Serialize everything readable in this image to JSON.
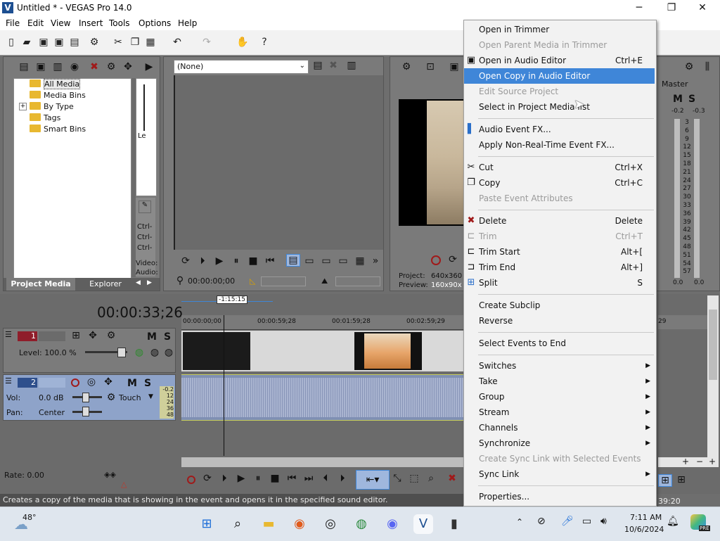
{
  "window": {
    "title": "Untitled * - VEGAS Pro 14.0",
    "minimize": "─",
    "maximize": "❐",
    "close": "✕"
  },
  "menubar": [
    "File",
    "Edit",
    "View",
    "Insert",
    "Tools",
    "Options",
    "Help"
  ],
  "explorer": {
    "tree": [
      "All Media",
      "Media Bins",
      "By Type",
      "Tags",
      "Smart Bins"
    ],
    "expander": "+",
    "tabs": [
      "Project Media",
      "Explorer"
    ],
    "side_text": [
      "Le",
      "Ctrl-",
      "Ctrl-",
      "Ctrl-",
      "Video:",
      "Audio:"
    ]
  },
  "trimmer": {
    "dropdown": "(None)",
    "timecode": "00:00:00;00"
  },
  "preview": {
    "project_label": "Project:",
    "project_value": "640x360",
    "preview_label": "Preview:",
    "preview_value": "160x90x"
  },
  "master": {
    "title": "Master",
    "mute": "M",
    "solo": "S",
    "peak_l": "-0.2",
    "peak_r": "-0.3",
    "scale": [
      "3",
      "6",
      "9",
      "12",
      "15",
      "18",
      "21",
      "24",
      "27",
      "30",
      "33",
      "36",
      "39",
      "42",
      "45",
      "48",
      "51",
      "54",
      "57"
    ],
    "bottom_l": "0.0",
    "bottom_r": "0.0"
  },
  "timeline": {
    "timecode": "00:00:33;26",
    "marker": "-1:15:15",
    "ruler": [
      "00:00:00;00",
      "00:00:59;28",
      "00:01:59;28",
      "00:02:59;29"
    ],
    "ruler_right": "29",
    "end_time": "39:20",
    "track1": {
      "number": "1",
      "level": "Level: 100.0 %",
      "mute": "M",
      "solo": "S"
    },
    "track2": {
      "number": "2",
      "vol_label": "Vol:",
      "vol_value": "0.0 dB",
      "pan_label": "Pan:",
      "pan_value": "Center",
      "automation": "Touch",
      "mute": "M",
      "solo": "S",
      "meter": [
        "-0.2",
        "12",
        "24",
        "36",
        "48"
      ]
    }
  },
  "transport": {
    "rate": "Rate: 0.00"
  },
  "status_bar": "Creates a copy of the media that is showing in the event and opens it in the specified sound editor.",
  "context_menu": [
    {
      "label": "Open in Trimmer",
      "shortcut": "",
      "enabled": true
    },
    {
      "label": "Open Parent Media in Trimmer",
      "shortcut": "",
      "enabled": false
    },
    {
      "label": "Open in Audio Editor",
      "shortcut": "Ctrl+E",
      "enabled": true
    },
    {
      "label": "Open Copy in Audio Editor",
      "shortcut": "",
      "enabled": true,
      "highlighted": true
    },
    {
      "label": "Edit Source Project",
      "shortcut": "",
      "enabled": false
    },
    {
      "label": "Select in Project Media list",
      "shortcut": "",
      "enabled": true
    },
    {
      "label": "Audio Event FX...",
      "shortcut": "",
      "enabled": true
    },
    {
      "label": "Apply Non-Real-Time Event FX...",
      "shortcut": "",
      "enabled": true
    },
    {
      "label": "Cut",
      "shortcut": "Ctrl+X",
      "enabled": true
    },
    {
      "label": "Copy",
      "shortcut": "Ctrl+C",
      "enabled": true
    },
    {
      "label": "Paste Event Attributes",
      "shortcut": "",
      "enabled": false
    },
    {
      "label": "Delete",
      "shortcut": "Delete",
      "enabled": true
    },
    {
      "label": "Trim",
      "shortcut": "Ctrl+T",
      "enabled": false
    },
    {
      "label": "Trim Start",
      "shortcut": "Alt+[",
      "enabled": true
    },
    {
      "label": "Trim End",
      "shortcut": "Alt+]",
      "enabled": true
    },
    {
      "label": "Split",
      "shortcut": "S",
      "enabled": true
    },
    {
      "label": "Create Subclip",
      "shortcut": "",
      "enabled": true
    },
    {
      "label": "Reverse",
      "shortcut": "",
      "enabled": true
    },
    {
      "label": "Select Events to End",
      "shortcut": "",
      "enabled": true
    },
    {
      "label": "Switches",
      "shortcut": "",
      "enabled": true,
      "submenu": true
    },
    {
      "label": "Take",
      "shortcut": "",
      "enabled": true,
      "submenu": true
    },
    {
      "label": "Group",
      "shortcut": "",
      "enabled": true,
      "submenu": true
    },
    {
      "label": "Stream",
      "shortcut": "",
      "enabled": true,
      "submenu": true
    },
    {
      "label": "Channels",
      "shortcut": "",
      "enabled": true,
      "submenu": true
    },
    {
      "label": "Synchronize",
      "shortcut": "",
      "enabled": true,
      "submenu": true
    },
    {
      "label": "Create Sync Link with Selected Events",
      "shortcut": "",
      "enabled": false
    },
    {
      "label": "Sync Link",
      "shortcut": "",
      "enabled": true,
      "submenu": true
    },
    {
      "label": "Properties...",
      "shortcut": "",
      "enabled": true
    }
  ],
  "taskbar": {
    "weather": "48°",
    "time": "7:11 AM",
    "date": "10/6/2024",
    "badge": "PRE"
  },
  "colors": {
    "highlight": "#3f86d8",
    "track_video": "#8f1d2a",
    "track_audio": "#2e4f8c"
  }
}
